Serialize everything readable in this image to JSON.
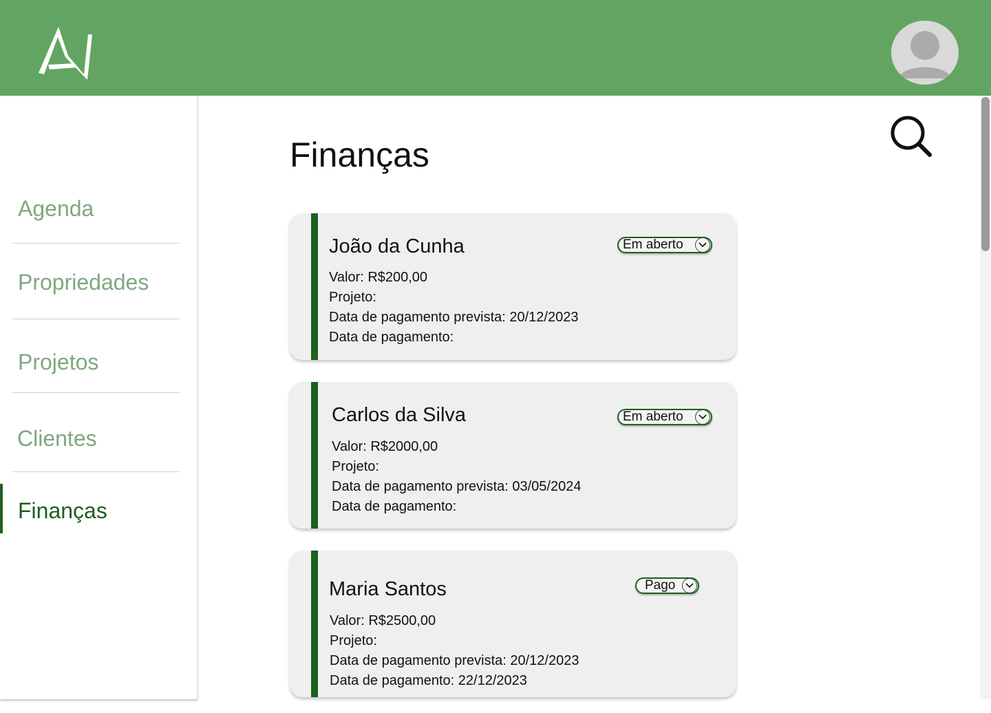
{
  "header": {
    "logo_icon": "app-logo-icon",
    "avatar_icon": "user-avatar-icon"
  },
  "sidebar": {
    "items": [
      {
        "label": "Agenda",
        "active": false
      },
      {
        "label": "Propriedades",
        "active": false
      },
      {
        "label": "Projetos",
        "active": false
      },
      {
        "label": "Clientes",
        "active": false
      },
      {
        "label": "Finanças",
        "active": true
      }
    ]
  },
  "main": {
    "title": "Finanças",
    "search_icon": "search-icon"
  },
  "cards": [
    {
      "name": "João da Cunha",
      "status": "Em aberto",
      "valor": "Valor: R$200,00",
      "projeto": "Projeto:",
      "data_prevista": "Data de pagamento prevista: 20/12/2023",
      "data_pagamento": "Data de pagamento:"
    },
    {
      "name": "Carlos da Silva",
      "status": "Em aberto",
      "valor": "Valor: R$2000,00",
      "projeto": "Projeto:",
      "data_prevista": "Data de pagamento prevista: 03/05/2024",
      "data_pagamento": "Data de pagamento:"
    },
    {
      "name": "Maria Santos",
      "status": "Pago",
      "valor": "Valor: R$2500,00",
      "projeto": "Projeto:",
      "data_prevista": "Data de pagamento prevista: 20/12/2023",
      "data_pagamento": "Data de pagamento:  22/12/2023"
    }
  ],
  "colors": {
    "header_bg": "#62a562",
    "accent_dark": "#1e5e1e",
    "nav_inactive": "#7fa87f",
    "card_bg": "#efefef"
  }
}
